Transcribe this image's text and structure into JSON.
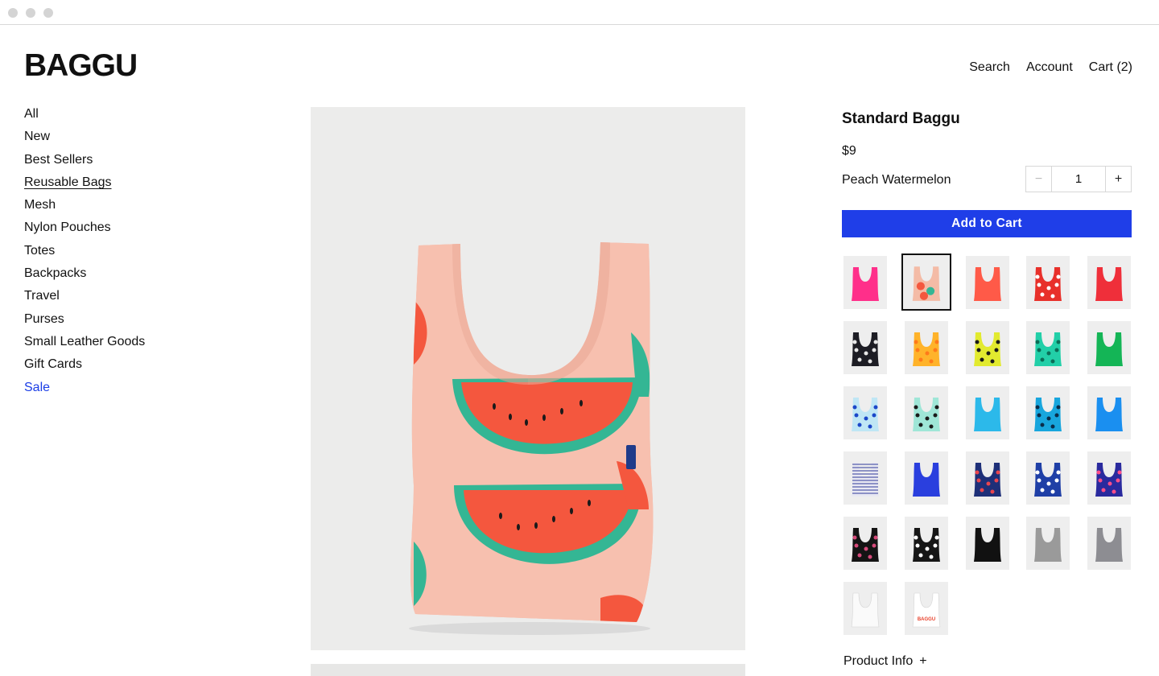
{
  "brand": {
    "logo": "BAGGU"
  },
  "topnav": {
    "search": "Search",
    "account": "Account",
    "cart": "Cart (2)"
  },
  "sidebar": {
    "items": [
      {
        "label": "All"
      },
      {
        "label": "New"
      },
      {
        "label": "Best Sellers"
      },
      {
        "label": "Reusable Bags",
        "active": true
      },
      {
        "label": "Mesh"
      },
      {
        "label": "Nylon Pouches"
      },
      {
        "label": "Totes"
      },
      {
        "label": "Backpacks"
      },
      {
        "label": "Travel"
      },
      {
        "label": "Purses"
      },
      {
        "label": "Small Leather Goods"
      },
      {
        "label": "Gift Cards"
      },
      {
        "label": "Sale",
        "sale": true
      }
    ]
  },
  "product": {
    "title": "Standard Baggu",
    "price": "$9",
    "color_name": "Peach Watermelon",
    "quantity": "1",
    "qty_minus": "−",
    "qty_plus": "+",
    "add_to_cart": "Add to Cart",
    "product_info": "Product Info",
    "product_info_toggle": "+"
  },
  "swatches": [
    {
      "color": "#ff2f8a",
      "pattern": "solid"
    },
    {
      "color": "#f4bba6",
      "pattern": "watermelon",
      "selected": true
    },
    {
      "color": "#ff5a48",
      "pattern": "solid"
    },
    {
      "color": "#e8302a",
      "pattern": "print",
      "accent": "#ffffff"
    },
    {
      "color": "#ef2f3a",
      "pattern": "solid"
    },
    {
      "color": "#1d1d24",
      "pattern": "print",
      "accent": "#e7e7e7"
    },
    {
      "color": "#ffb32a",
      "pattern": "print",
      "accent": "#ff7a1a"
    },
    {
      "color": "#e2ea2f",
      "pattern": "print",
      "accent": "#1a1a1a"
    },
    {
      "color": "#22cfa8",
      "pattern": "print",
      "accent": "#0b6d57"
    },
    {
      "color": "#14b556",
      "pattern": "solid"
    },
    {
      "color": "#bfe6f5",
      "pattern": "print",
      "accent": "#1b47c9"
    },
    {
      "color": "#9fe6d7",
      "pattern": "print",
      "accent": "#1a1a1a"
    },
    {
      "color": "#2cb9ea",
      "pattern": "solid"
    },
    {
      "color": "#18a6dd",
      "pattern": "print",
      "accent": "#0a2d4a"
    },
    {
      "color": "#1a8ff0",
      "pattern": "solid"
    },
    {
      "color": "#e8e8f2",
      "pattern": "stripes",
      "accent": "#2f3a9a"
    },
    {
      "color": "#2a3fde",
      "pattern": "solid"
    },
    {
      "color": "#1e2f78",
      "pattern": "print",
      "accent": "#e9454e"
    },
    {
      "color": "#1f3fa6",
      "pattern": "print",
      "accent": "#ffffff"
    },
    {
      "color": "#2a2a9e",
      "pattern": "print",
      "accent": "#ff4e8a"
    },
    {
      "color": "#141414",
      "pattern": "print",
      "accent": "#d64a7a"
    },
    {
      "color": "#161616",
      "pattern": "print",
      "accent": "#ffffff"
    },
    {
      "color": "#111111",
      "pattern": "solid"
    },
    {
      "color": "#9a9a9a",
      "pattern": "solid"
    },
    {
      "color": "#8d8d92",
      "pattern": "solid"
    },
    {
      "color": "#fafafa",
      "pattern": "solid"
    },
    {
      "color": "#ffffff",
      "pattern": "logo",
      "accent": "#e8402a",
      "logo_text": "BAGGU"
    }
  ],
  "colors": {
    "accent": "#1f3ee8",
    "sale": "#1a3de6",
    "bag_base": "#f6b8a6",
    "watermelon_red": "#f2573f",
    "rind_green": "#2fb694"
  }
}
